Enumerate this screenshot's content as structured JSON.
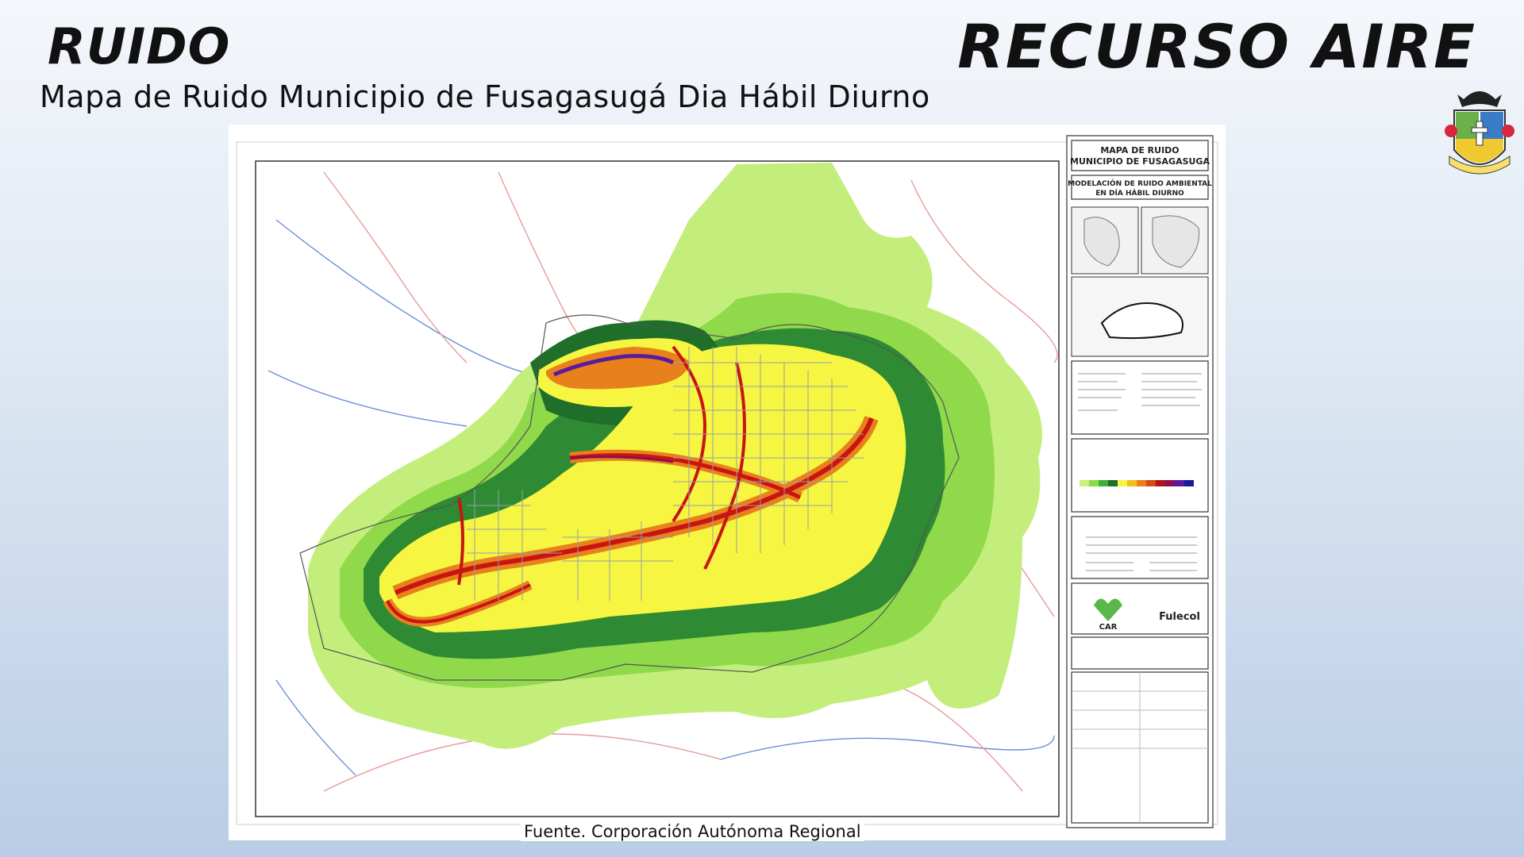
{
  "header": {
    "section_title": "RUIDO",
    "main_title": "RECURSO AIRE",
    "subtitle": "Mapa de Ruido Municipio de Fusagasugá Dia Hábil  Diurno"
  },
  "map": {
    "legend_title": "MAPA DE RUIDO\nMUNICIPIO DE FUSAGASUGA",
    "legend_title_line1": "MAPA DE RUIDO",
    "legend_title_line2": "MUNICIPIO DE FUSAGASUGA",
    "legend_subtitle_line1": "MODELACIÓN DE RUIDO AMBIENTAL",
    "legend_subtitle_line2": "EN DÍA HÁBIL DIURNO",
    "logo_car": "CAR",
    "logo_fulecol": "Fulecol",
    "noise_colors": [
      "#c8f07a",
      "#8fd94a",
      "#3fae3a",
      "#1f6e2a",
      "#f5f542",
      "#f0c020",
      "#e8801c",
      "#d64a1a",
      "#b01414",
      "#8a1050",
      "#5a1aa0",
      "#1a1a9a"
    ]
  },
  "footer": {
    "source": "Fuente. Corporación Autónoma Regional"
  }
}
